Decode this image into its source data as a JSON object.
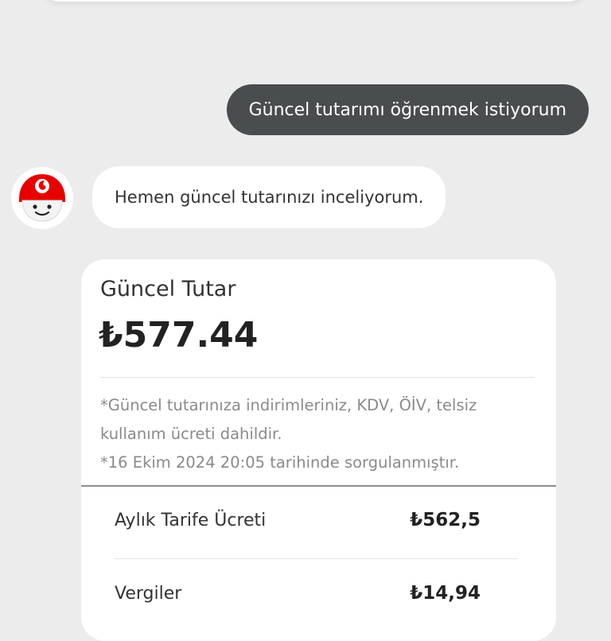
{
  "chat": {
    "user_message": "Güncel tutarımı öğrenmek istiyorum",
    "bot_message": "Hemen güncel tutarınızı inceliyorum."
  },
  "bill_card": {
    "title": "Güncel Tutar",
    "amount": "₺577.44",
    "note_line1": "*Güncel tutarınıza indirimleriniz, KDV, ÖİV, telsiz",
    "note_line2": "kullanım ücreti dahildir.",
    "note_line3": "*16 Ekim 2024 20:05  tarihinde sorgulanmıştır.",
    "rows": [
      {
        "label": "Aylık Tarife Ücreti",
        "value": "₺562,5"
      },
      {
        "label": "Vergiler",
        "value": "₺14,94"
      }
    ]
  },
  "colors": {
    "background": "#ececec",
    "user_bubble": "#4a4d4e",
    "brand_red": "#e60000",
    "note_text": "#8a8a8a"
  },
  "icons": {
    "avatar": "vodafone-mascot-avatar"
  }
}
